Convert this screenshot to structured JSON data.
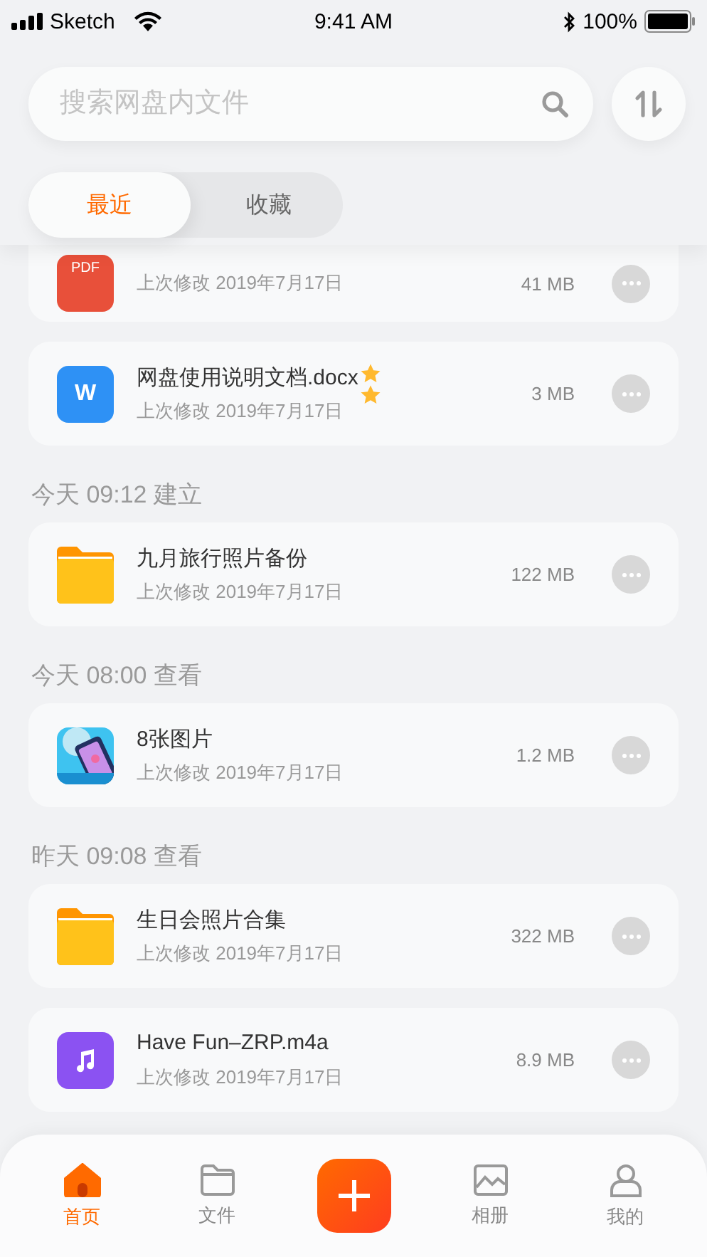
{
  "status_bar": {
    "carrier": "Sketch",
    "time": "9:41 AM",
    "battery": "100%"
  },
  "search": {
    "placeholder": "搜索网盘内文件"
  },
  "tabs": [
    {
      "label": "最近",
      "selected": true
    },
    {
      "label": "收藏",
      "selected": false
    }
  ],
  "sections": [
    {
      "files": [
        {
          "kind": "pdf",
          "badge": "PDF",
          "date": "上次修改 2019年7月17日",
          "size": "41 MB"
        },
        {
          "kind": "word",
          "badge": "W",
          "name": "网盘使用说明文档.docx",
          "favorite": true,
          "date": "上次修改 2019年7月17日",
          "size": "3 MB"
        }
      ]
    },
    {
      "label": "今天 09:12 建立",
      "files": [
        {
          "kind": "folder",
          "name": "九月旅行照片备份",
          "date": "上次修改 2019年7月17日",
          "size": "122 MB"
        }
      ]
    },
    {
      "label": "今天 08:00 查看",
      "files": [
        {
          "name": "8张图片",
          "date": "上次修改 2019年7月17日",
          "size": "1.2 MB"
        }
      ]
    },
    {
      "label": "昨天 09:08 查看",
      "files": [
        {
          "kind": "folder",
          "name": "生日会照片合集",
          "date": "上次修改 2019年7月17日",
          "size": "322 MB"
        },
        {
          "kind": "audio",
          "name": "Have Fun–ZRP.m4a",
          "date": "上次修改 2019年7月17日",
          "size": "8.9 MB"
        }
      ]
    }
  ],
  "nav": [
    {
      "kind": "home",
      "label": "首页",
      "selected": true
    },
    {
      "kind": "folder",
      "label": "文件",
      "selected": false
    },
    {
      "kind": "add"
    },
    {
      "kind": "album",
      "label": "相册",
      "selected": false
    },
    {
      "kind": "user",
      "label": "我的",
      "selected": false
    }
  ]
}
